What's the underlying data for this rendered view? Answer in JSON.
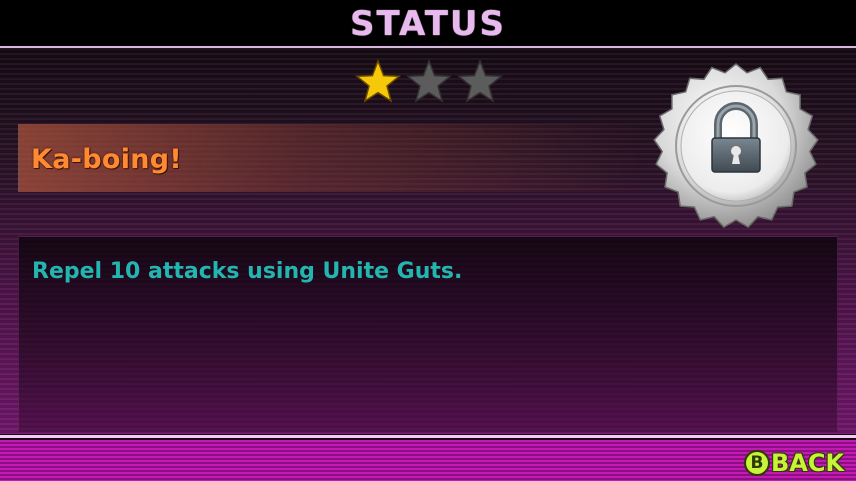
{
  "header": {
    "title": "STATUS"
  },
  "rating": {
    "filled": 1,
    "max": 3,
    "filled_color": "#f5c90a",
    "empty_color": "#5c5c5c"
  },
  "achievement": {
    "title": "Ka-boing!",
    "description": "Repel 10 attacks using Unite Guts.",
    "badge": {
      "icon": "bottle-cap-padlock-icon",
      "state": "locked"
    }
  },
  "footer": {
    "back_button_icon": "B",
    "back_button_label": "BACK"
  },
  "colors": {
    "header_title": "#e8b8ee",
    "title_text": "#ff8a32",
    "description_text": "#23b6b0",
    "footer_bar": "#c21ab2",
    "back_button": "#c9f23a"
  }
}
